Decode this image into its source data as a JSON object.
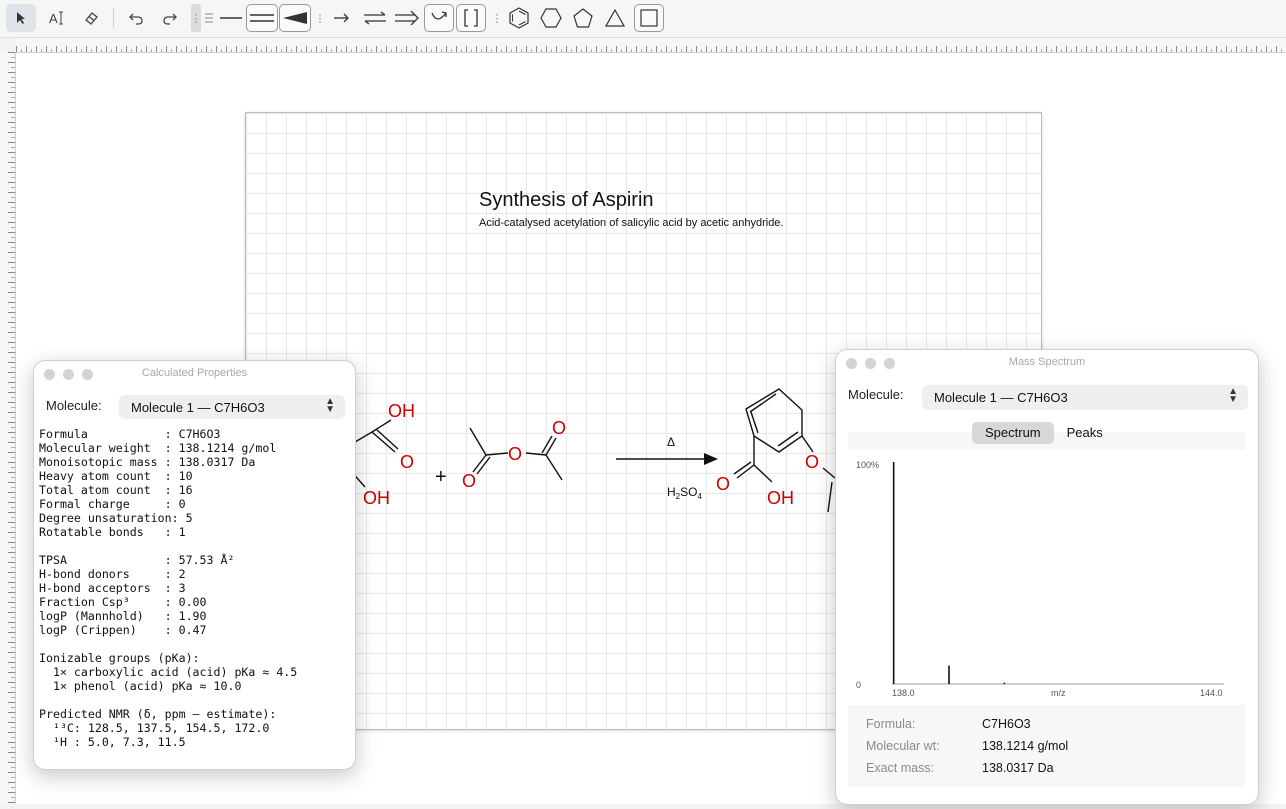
{
  "toolbar": {
    "tools": [
      "select-arrow",
      "text-tool",
      "eraser",
      "undo",
      "redo",
      "single-bond",
      "double-bond",
      "wedge-bond",
      "arrow",
      "equilibrium-arrow",
      "retrosynthesis-arrow",
      "curved-arrow",
      "brackets",
      "benzene-ring",
      "hexagon",
      "pentagon",
      "triangle",
      "square"
    ]
  },
  "document": {
    "title": "Synthesis of Aspirin",
    "subtitle": "Acid-catalysed acetylation of salicylic acid by acetic anhydride.",
    "reaction": {
      "plus": "+",
      "condition_top": "Δ",
      "condition_bottom_main": "H",
      "condition_bottom_sub1": "2",
      "condition_bottom_mid": "SO",
      "condition_bottom_sub2": "4"
    },
    "atoms": {
      "salicylic_oh_top": "OH",
      "salicylic_o": "O",
      "salicylic_oh_bottom": "OH",
      "anhydride_o1": "O",
      "anhydride_o2": "O",
      "anhydride_o3": "O",
      "product_o_ester": "O",
      "product_o_carbonyl": "O",
      "product_oh": "OH"
    }
  },
  "properties_panel": {
    "window_title": "Calculated Properties",
    "molecule_label": "Molecule:",
    "molecule_value": "Molecule 1  —  C7H6O3",
    "text": "Formula           : C7H6O3\nMolecular weight  : 138.1214 g/mol\nMonoisotopic mass : 138.0317 Da\nHeavy atom count  : 10\nTotal atom count  : 16\nFormal charge     : 0\nDegree unsaturation: 5\nRotatable bonds   : 1\n\nTPSA              : 57.53 Å²\nH-bond donors     : 2\nH-bond acceptors  : 3\nFraction Csp³     : 0.00\nlogP (Mannhold)   : 1.90\nlogP (Crippen)    : 0.47\n\nIonizable groups (pKa):\n  1× carboxylic acid (acid) pKa ≈ 4.5\n  1× phenol (acid) pKa ≈ 10.0\n\nPredicted NMR (δ, ppm — estimate):\n  ¹³C: 128.5, 137.5, 154.5, 172.0\n  ¹H : 5.0, 7.3, 11.5"
  },
  "spectrum_panel": {
    "window_title": "Mass Spectrum",
    "molecule_label": "Molecule:",
    "molecule_value": "Molecule 1  —  C7H6O3",
    "tabs": [
      {
        "label": "Spectrum",
        "active": true
      },
      {
        "label": "Peaks",
        "active": false
      }
    ],
    "info": [
      {
        "key": "Formula:",
        "value": "C7H6O3"
      },
      {
        "key": "Molecular wt:",
        "value": "138.1214 g/mol"
      },
      {
        "key": "Exact mass:",
        "value": "138.0317 Da"
      }
    ]
  },
  "chart_data": {
    "type": "bar",
    "title": "",
    "xlabel": "m/z",
    "ylabel": "",
    "xlim": [
      138.0,
      144.0
    ],
    "ylim": [
      0,
      100
    ],
    "y_tick_labels": [
      "100%",
      "0"
    ],
    "x_tick_labels": [
      "138.0",
      "144.0"
    ],
    "peaks": [
      {
        "x": 138.03,
        "y": 100
      },
      {
        "x": 139.03,
        "y": 8.3
      },
      {
        "x": 140.03,
        "y": 0.6
      }
    ]
  },
  "colors": {
    "heteroatom": "#cc0000",
    "bond": "#111111",
    "grid": "#e8e8e8",
    "active_tool": "#dfe3ea"
  }
}
